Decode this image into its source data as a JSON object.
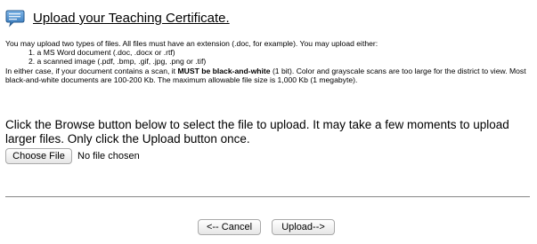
{
  "header": {
    "title": "Upload your Teaching Certificate."
  },
  "intro": {
    "lead": "You may upload two types of files. All files must have an extension (.doc, for example). You may upload either:",
    "file_types": [
      "1. a MS Word document (.doc, .docx or .rtf)",
      "2. a scanned image (.pdf, .bmp, .gif, .jpg, .png or .tif)"
    ],
    "note_before": "In either case, if your document contains a scan, it ",
    "note_bold": "MUST be black-and-white",
    "note_after": " (1 bit). Color and grayscale scans are too large for the district to view. Most black-and-white documents are 100-200 Kb. The maximum allowable file size is 1,000 Kb (1 megabyte)."
  },
  "instructions": "Click the Browse button below to select the file to upload. It may take a few moments to upload larger files. Only click the Upload button once.",
  "file_input": {
    "button_label": "Choose File",
    "status": "No file chosen"
  },
  "actions": {
    "cancel_label": "<-- Cancel",
    "upload_label": "Upload-->"
  },
  "colors": {
    "icon_fill": "#3d84c6",
    "icon_border": "#27598c",
    "divider": "#9a9a9a"
  },
  "icons": {
    "header_icon": "chat-bubble-icon"
  }
}
